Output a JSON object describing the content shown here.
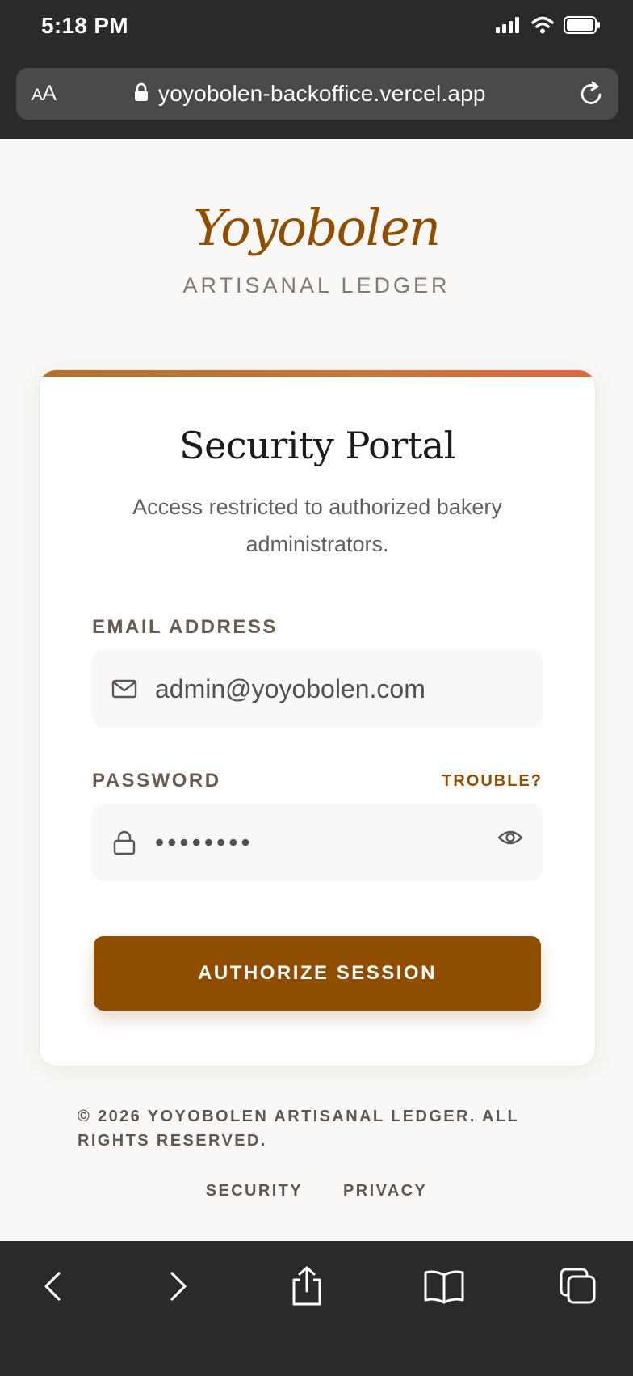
{
  "status_bar": {
    "time": "5:18 PM"
  },
  "browser": {
    "text_size_label_small": "A",
    "text_size_label_large": "A",
    "url": "yoyobolen-backoffice.vercel.app"
  },
  "brand": {
    "name": "Yoyobolen",
    "tagline": "ARTISANAL LEDGER"
  },
  "login": {
    "title": "Security Portal",
    "description": "Access restricted to authorized bakery administrators.",
    "email_label": "EMAIL ADDRESS",
    "email_value": "admin@yoyobolen.com",
    "password_label": "PASSWORD",
    "trouble_link": "TROUBLE?",
    "password_masked": "••••••••",
    "submit_label": "AUTHORIZE SESSION"
  },
  "footer": {
    "copyright": "© 2026 YOYOBOLEN ARTISANAL LEDGER. ALL RIGHTS RESERVED.",
    "links": [
      "SECURITY",
      "PRIVACY"
    ]
  },
  "icons": {
    "email": "mail-icon",
    "password": "lock-icon",
    "reveal": "eye-icon"
  },
  "colors": {
    "brand_accent": "#8f4d00",
    "chrome": "#2a2a2a",
    "page_bg": "#f9f8f6"
  }
}
